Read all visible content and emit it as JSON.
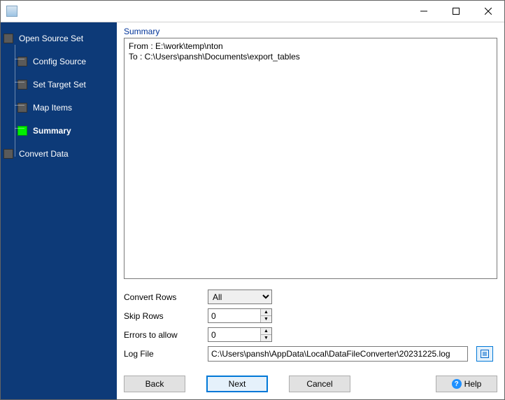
{
  "window": {
    "title": ""
  },
  "sidebar": {
    "steps": [
      {
        "label": "Open Source Set"
      },
      {
        "label": "Config Source"
      },
      {
        "label": "Set Target Set"
      },
      {
        "label": "Map Items"
      },
      {
        "label": "Summary"
      },
      {
        "label": "Convert Data"
      }
    ],
    "current_index": 4
  },
  "main": {
    "section_label": "Summary",
    "from_line": "From : E:\\work\\temp\\nton",
    "to_line": "To : C:\\Users\\pansh\\Documents\\export_tables"
  },
  "form": {
    "convert_rows": {
      "label": "Convert Rows",
      "value": "All",
      "options": [
        "All"
      ]
    },
    "skip_rows": {
      "label": "Skip Rows",
      "value": "0"
    },
    "errors_allow": {
      "label": "Errors to allow",
      "value": "0"
    },
    "log_file": {
      "label": "Log File",
      "value": "C:\\Users\\pansh\\AppData\\Local\\DataFileConverter\\20231225.log"
    }
  },
  "buttons": {
    "back": "Back",
    "next": "Next",
    "cancel": "Cancel",
    "help": "Help"
  }
}
